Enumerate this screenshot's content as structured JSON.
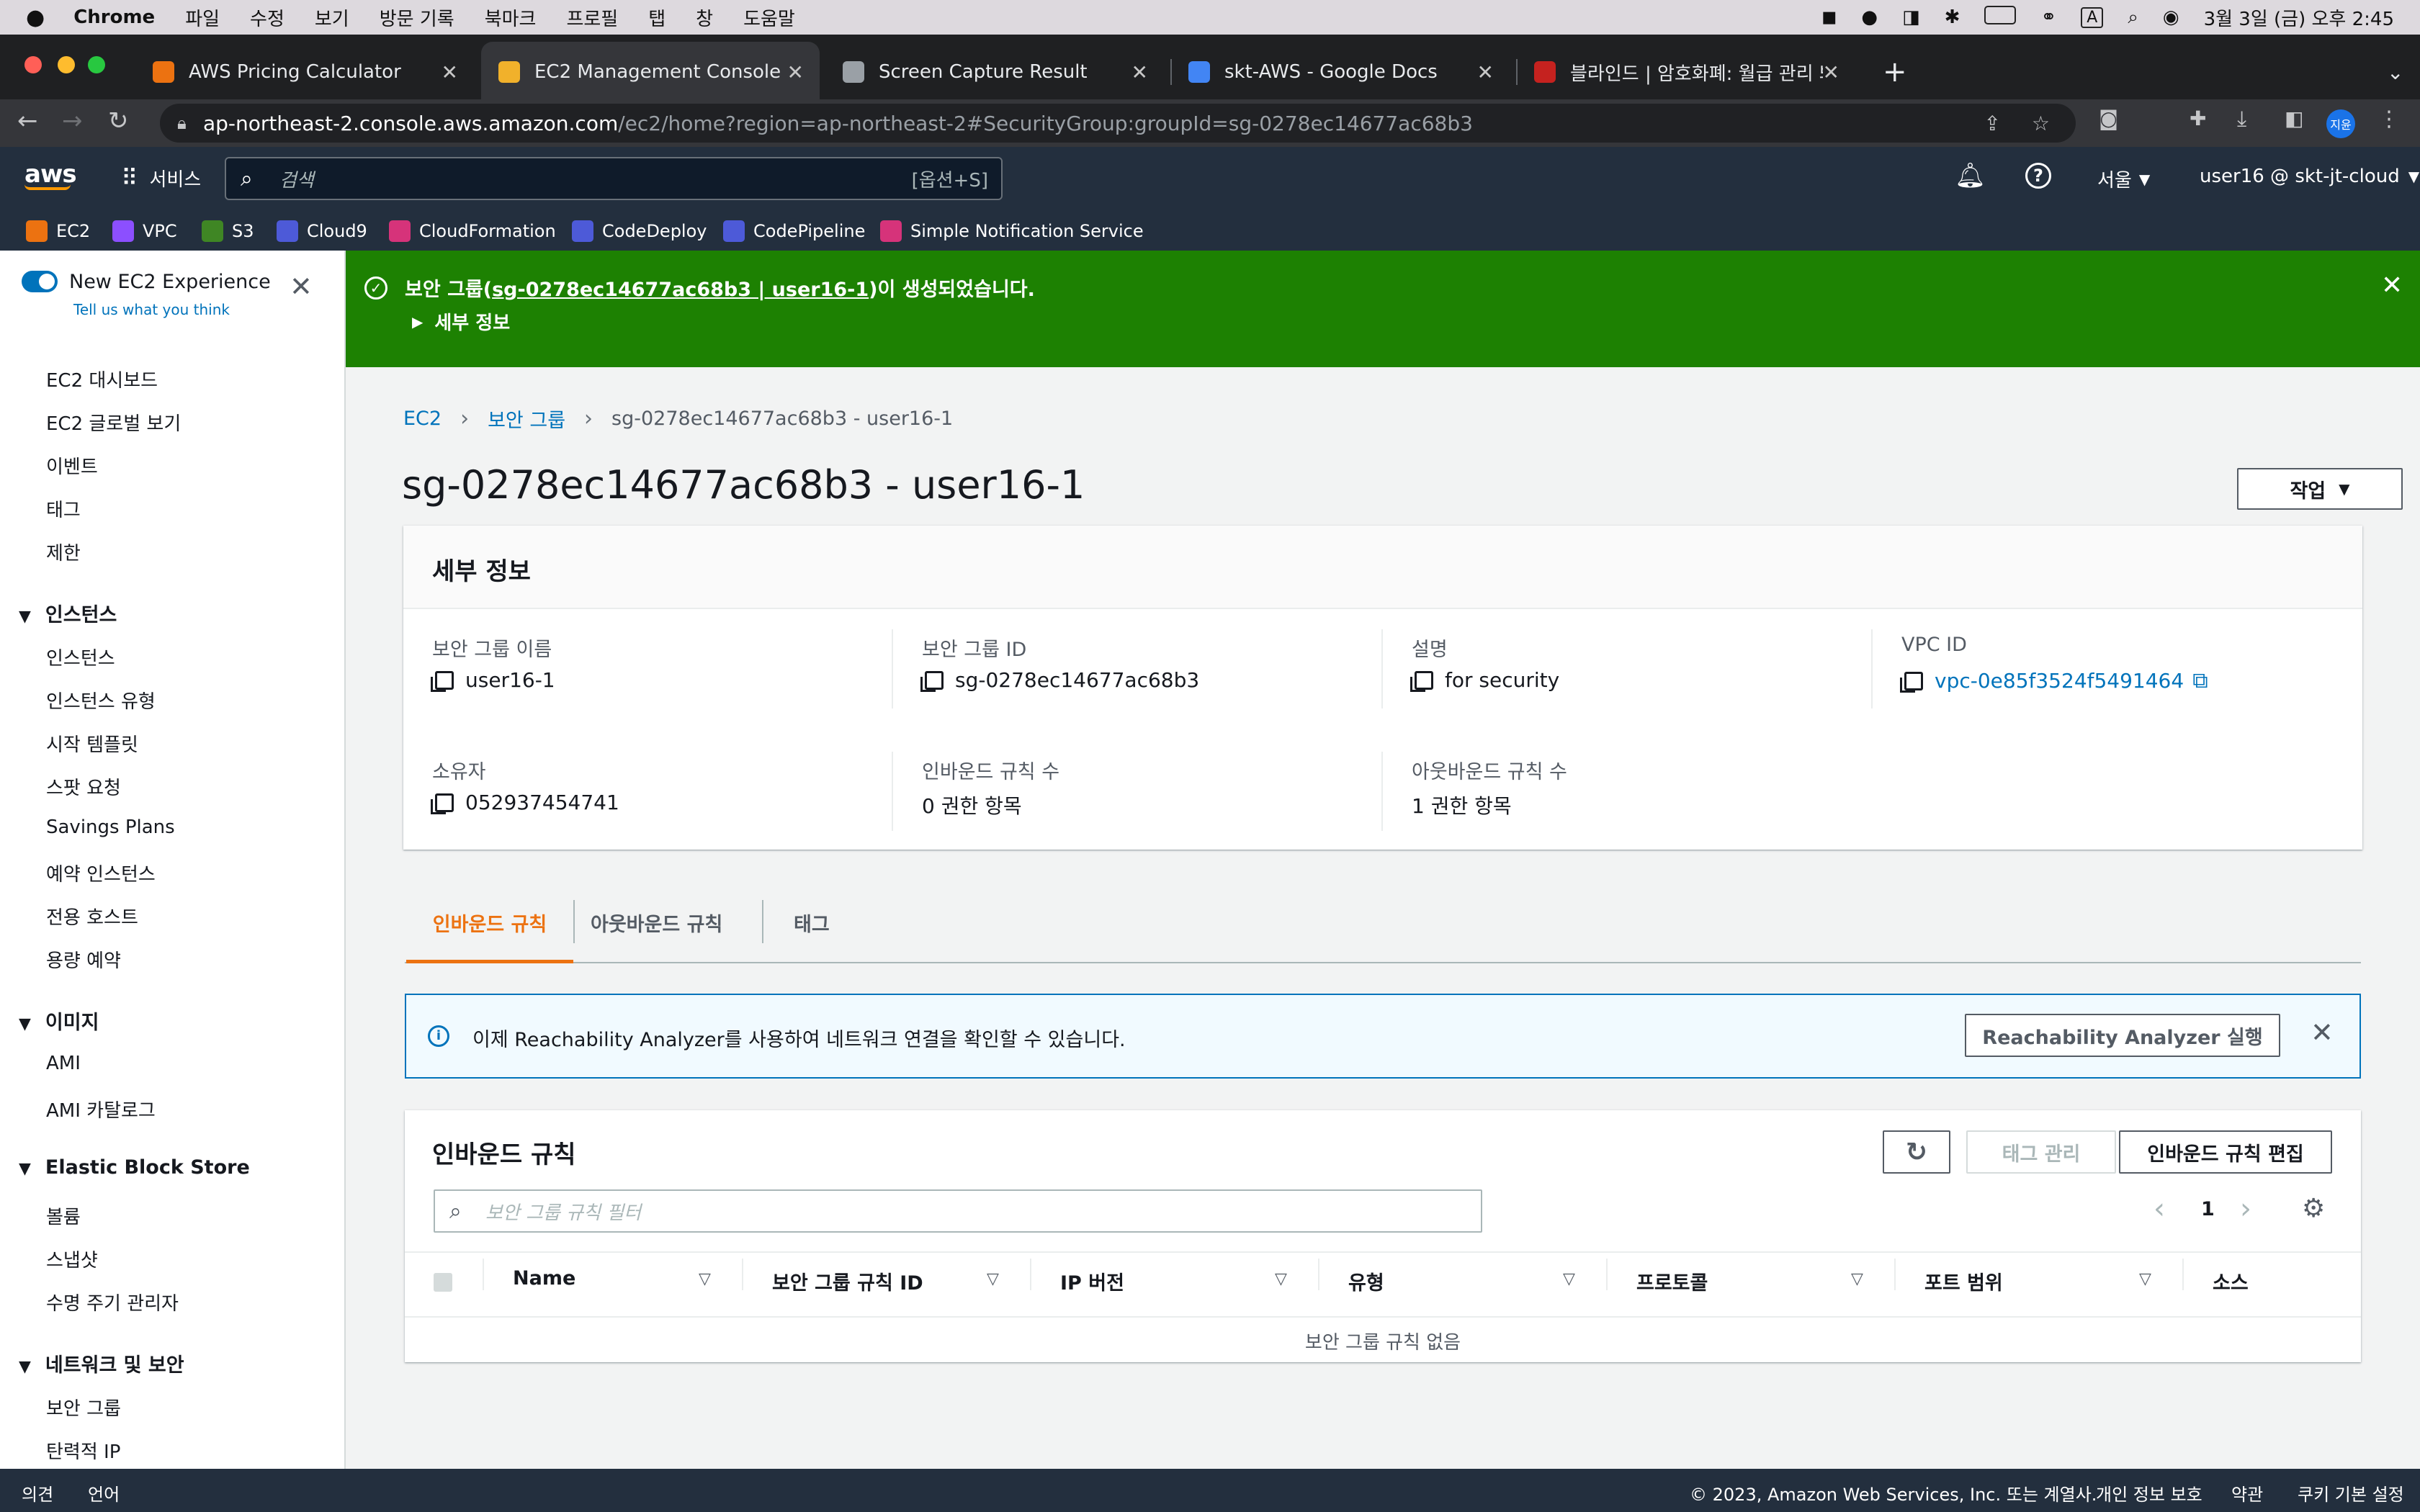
{
  "macbar": {
    "app": "Chrome",
    "menus": [
      "파일",
      "수정",
      "보기",
      "방문 기록",
      "북마크",
      "프로필",
      "탭",
      "창",
      "도움말"
    ],
    "clock": "3월 3일 (금) 오후 2:45"
  },
  "tabs": [
    {
      "title": "AWS Pricing Calculator"
    },
    {
      "title": "EC2 Management Console"
    },
    {
      "title": "Screen Capture Result"
    },
    {
      "title": "skt-AWS - Google Docs"
    },
    {
      "title": "블라인드 | 암호화폐: 월급 관리 봐주세요"
    }
  ],
  "address": {
    "url_host": "ap-northeast-2.console.aws.amazon.com",
    "url_path": "/ec2/home?region=ap-northeast-2#SecurityGroup:groupId=sg-0278ec14677ac68b3",
    "profile": "지윤"
  },
  "aws_header": {
    "services": "서비스",
    "search_placeholder": "검색",
    "search_shortcut": "[옵션+S]",
    "region": "서울",
    "account": "user16 @ skt-jt-cloud"
  },
  "favorites": [
    "EC2",
    "VPC",
    "S3",
    "Cloud9",
    "CloudFormation",
    "CodeDeploy",
    "CodePipeline",
    "Simple Notification Service"
  ],
  "sidebar": {
    "toggle_label": "New EC2 Experience",
    "feedback": "Tell us what you think",
    "top_items": [
      "EC2 대시보드",
      "EC2 글로벌 보기",
      "이벤트",
      "태그",
      "제한"
    ],
    "sections": [
      {
        "title": "인스턴스",
        "items": [
          "인스턴스",
          "인스턴스 유형",
          "시작 템플릿",
          "스팟 요청",
          "Savings Plans",
          "예약 인스턴스",
          "전용 호스트",
          "용량 예약"
        ]
      },
      {
        "title": "이미지",
        "items": [
          "AMI",
          "AMI 카탈로그"
        ]
      },
      {
        "title": "Elastic Block Store",
        "items": [
          "볼륨",
          "스냅샷",
          "수명 주기 관리자"
        ]
      },
      {
        "title": "네트워크 및 보안",
        "items": [
          "보안 그룹",
          "탄력적 IP"
        ]
      }
    ]
  },
  "flash": {
    "prefix": "보안 그룹(",
    "link": "sg-0278ec14677ac68b3 | user16-1",
    "suffix": ")이 생성되었습니다.",
    "details": "세부 정보"
  },
  "breadcrumb": {
    "ec2": "EC2",
    "sg": "보안 그룹",
    "current": "sg-0278ec14677ac68b3 - user16-1"
  },
  "page_title": "sg-0278ec14677ac68b3 - user16-1",
  "actions_button": "작업",
  "details": {
    "header": "세부 정보",
    "name_label": "보안 그룹 이름",
    "name": "user16-1",
    "id_label": "보안 그룹 ID",
    "id": "sg-0278ec14677ac68b3",
    "desc_label": "설명",
    "desc": "for security",
    "vpc_label": "VPC ID",
    "vpc": "vpc-0e85f3524f5491464",
    "owner_label": "소유자",
    "owner": "052937454741",
    "inbound_label": "인바운드 규칙 수",
    "inbound": "0 권한 항목",
    "outbound_label": "아웃바운드 규칙 수",
    "outbound": "1 권한 항목"
  },
  "tabs_content": [
    "인바운드 규칙",
    "아웃바운드 규칙",
    "태그"
  ],
  "info_banner": {
    "text": "이제 Reachability Analyzer를 사용하여 네트워크 연결을 확인할 수 있습니다.",
    "button": "Reachability Analyzer 실행"
  },
  "rules": {
    "title": "인바운드 규칙",
    "manage_tags": "태그 관리",
    "edit": "인바운드 규칙 편집",
    "filter_placeholder": "보안 그룹 규칙 필터",
    "page": "1",
    "columns": [
      "Name",
      "보안 그룹 규칙 ID",
      "IP 버전",
      "유형",
      "프로토콜",
      "포트 범위",
      "소스"
    ],
    "empty": "보안 그룹 규칙 없음"
  },
  "footer": {
    "feedback": "의견",
    "language": "언어",
    "copyright": "© 2023, Amazon Web Services, Inc. 또는 계열사.",
    "privacy": "개인 정보 보호",
    "terms": "약관",
    "cookies": "쿠키 기본 설정"
  },
  "colors": {
    "aws_orange": "#ec7211",
    "flash_green": "#1d8102",
    "link_blue": "#0073bb",
    "header_navy": "#232f3e"
  }
}
